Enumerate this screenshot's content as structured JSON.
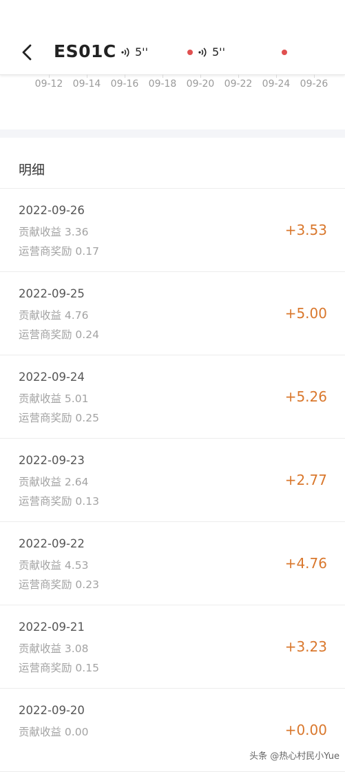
{
  "header": {
    "title": "ES01C",
    "voice1": "5''",
    "voice2": "5''"
  },
  "chart_axis": {
    "ticks": [
      "09-12",
      "09-14",
      "09-16",
      "09-18",
      "09-20",
      "09-22",
      "09-24",
      "09-26"
    ]
  },
  "details": {
    "title": "明细",
    "rows": [
      {
        "date": "2022-09-26",
        "contribution": "贡献收益 3.36",
        "reward": "运营商奖励 0.17",
        "amount": "+3.53"
      },
      {
        "date": "2022-09-25",
        "contribution": "贡献收益 4.76",
        "reward": "运营商奖励 0.24",
        "amount": "+5.00"
      },
      {
        "date": "2022-09-24",
        "contribution": "贡献收益 5.01",
        "reward": "运营商奖励 0.25",
        "amount": "+5.26"
      },
      {
        "date": "2022-09-23",
        "contribution": "贡献收益 2.64",
        "reward": "运营商奖励 0.13",
        "amount": "+2.77"
      },
      {
        "date": "2022-09-22",
        "contribution": "贡献收益 4.53",
        "reward": "运营商奖励 0.23",
        "amount": "+4.76"
      },
      {
        "date": "2022-09-21",
        "contribution": "贡献收益 3.08",
        "reward": "运营商奖励 0.15",
        "amount": "+3.23"
      },
      {
        "date": "2022-09-20",
        "contribution": "贡献收益 0.00",
        "reward": "",
        "amount": "+0.00"
      }
    ]
  },
  "watermark": "头条 @热心村民小Yue",
  "colors": {
    "amount": "#d9772c",
    "recording_dot": "#e05050"
  }
}
